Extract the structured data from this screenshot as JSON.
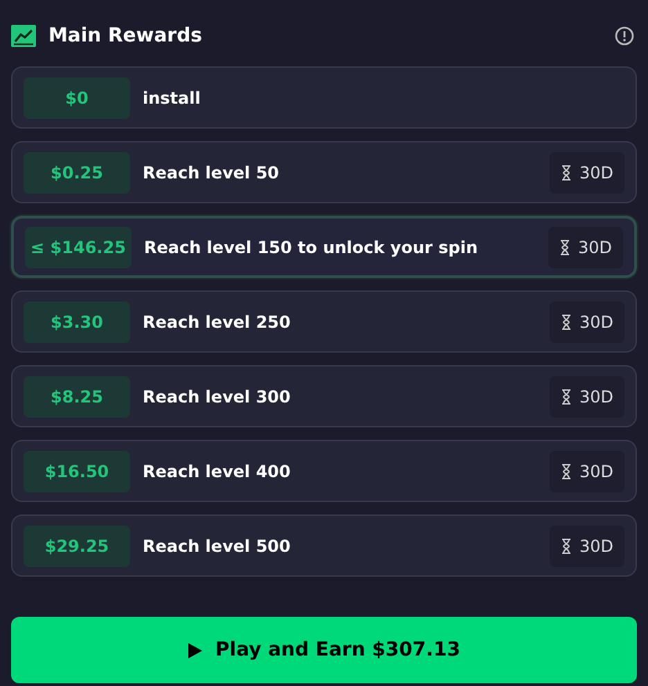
{
  "header": {
    "title": "Main Rewards"
  },
  "rewards": [
    {
      "amount": "$0",
      "label": "install",
      "highlighted": false
    },
    {
      "amount": "$0.25",
      "label": "Reach level 50",
      "timer": "30D",
      "highlighted": false
    },
    {
      "amount": "≤ $146.25",
      "label": "Reach level 150 to unlock your spin",
      "timer": "30D",
      "highlighted": true
    },
    {
      "amount": "$3.30",
      "label": "Reach level 250",
      "timer": "30D",
      "highlighted": false
    },
    {
      "amount": "$8.25",
      "label": "Reach level 300",
      "timer": "30D",
      "highlighted": false
    },
    {
      "amount": "$16.50",
      "label": "Reach level 400",
      "timer": "30D",
      "highlighted": false
    },
    {
      "amount": "$29.25",
      "label": "Reach level 500",
      "timer": "30D",
      "highlighted": false
    }
  ],
  "play_button": {
    "label": "Play and Earn $307.13"
  }
}
